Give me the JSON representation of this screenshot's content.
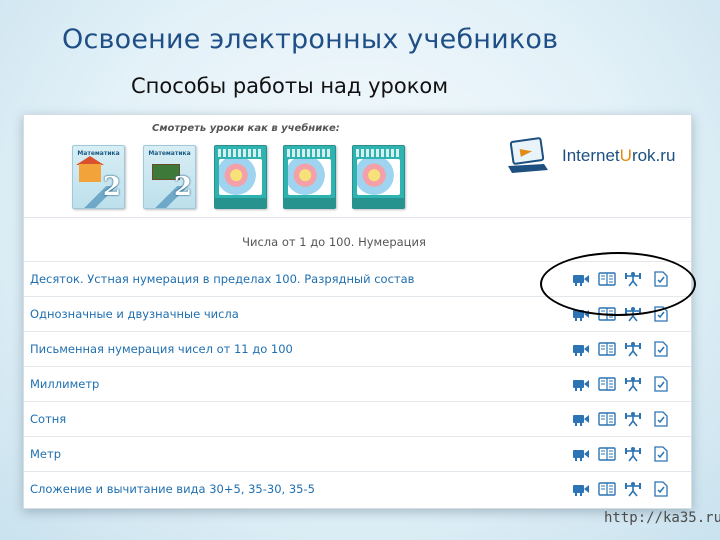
{
  "slide": {
    "title": "Освоение электронных учебников",
    "subtitle": "Способы работы над уроком",
    "source": "http://ka35.ru/"
  },
  "panel": {
    "books_caption": "Смотреть уроки как в учебнике:",
    "books": [
      {
        "title": "Математика",
        "number": "2"
      },
      {
        "title": "Математика",
        "number": "2"
      },
      {
        "title": ""
      },
      {
        "title": ""
      },
      {
        "title": ""
      }
    ],
    "logo": {
      "part1": "Internet",
      "part2": "U",
      "part3": "rok.ru"
    },
    "section_title": "Числа от 1 до 100. Нумерация",
    "lessons": [
      "Десяток. Устная нумерация в пределах 100. Разрядный состав",
      "Однозначные и двузначные числа",
      "Письменная нумерация чисел от 11 до 100",
      "Миллиметр",
      "Сотня",
      "Метр",
      "Сложение и вычитание вида 30+5, 35-30, 35-5"
    ],
    "lesson_icons": [
      "video-icon",
      "notes-icon",
      "exercise-icon",
      "test-icon"
    ],
    "side_tab": "‹"
  },
  "colors": {
    "title": "#1f4f86",
    "lesson_link": "#1f6fb0",
    "icon": "#2c74b3",
    "side_tab": "#7cc03a",
    "logo_orange": "#e38a14"
  }
}
